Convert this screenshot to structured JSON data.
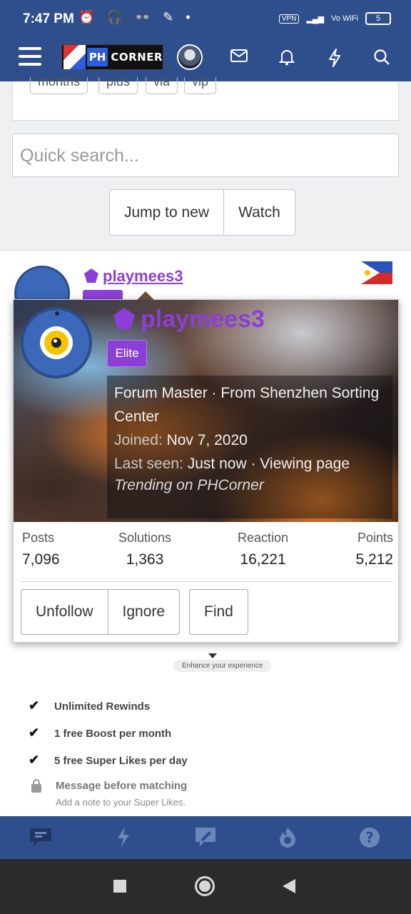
{
  "status_bar": {
    "time": "7:47 PM",
    "indicators": "⏰ 🎧 👓 ✎ •",
    "vpn": "VPN",
    "signal": "▂▄▆",
    "wifi_label": "Vo WiFi",
    "battery": "5"
  },
  "header": {
    "logo_ph": "PH",
    "logo_corner": "CORNER",
    "icons": [
      "menu-icon",
      "avatar",
      "mail-icon",
      "bell-icon",
      "bolt-icon",
      "search-icon"
    ]
  },
  "tags": [
    "months",
    "plus",
    "via",
    "vip"
  ],
  "search": {
    "placeholder": "Quick search..."
  },
  "thread_buttons": {
    "jump": "Jump to new",
    "watch": "Watch"
  },
  "post": {
    "username": "playmees3",
    "country_flag": "Philippines"
  },
  "popup": {
    "username": "playmees3",
    "badge": "Elite",
    "title_line": "Forum Master · From Shenzhen Sorting Center",
    "joined_label": "Joined:",
    "joined_value": "Nov 7, 2020",
    "last_seen_label": "Last seen:",
    "last_seen_value": "Just now · Viewing page",
    "activity": "Trending on PHCorner",
    "stats": [
      {
        "label": "Posts",
        "value": "7,096"
      },
      {
        "label": "Solutions",
        "value": "1,363"
      },
      {
        "label": "Reaction",
        "value": "16,221"
      },
      {
        "label": "Points",
        "value": "5,212"
      }
    ],
    "actions": {
      "unfollow": "Unfollow",
      "ignore": "Ignore",
      "find": "Find"
    }
  },
  "ad": {
    "pill": "Enhance your experience",
    "features": [
      "Unlimited Rewinds",
      "1 free Boost per month",
      "5 free Super Likes per day"
    ],
    "locked_feature": "Message before matching",
    "locked_note": "Add a note to your Super Likes."
  },
  "colors": {
    "brand": "#2f4f8c",
    "elite": "#8b3fd6"
  }
}
